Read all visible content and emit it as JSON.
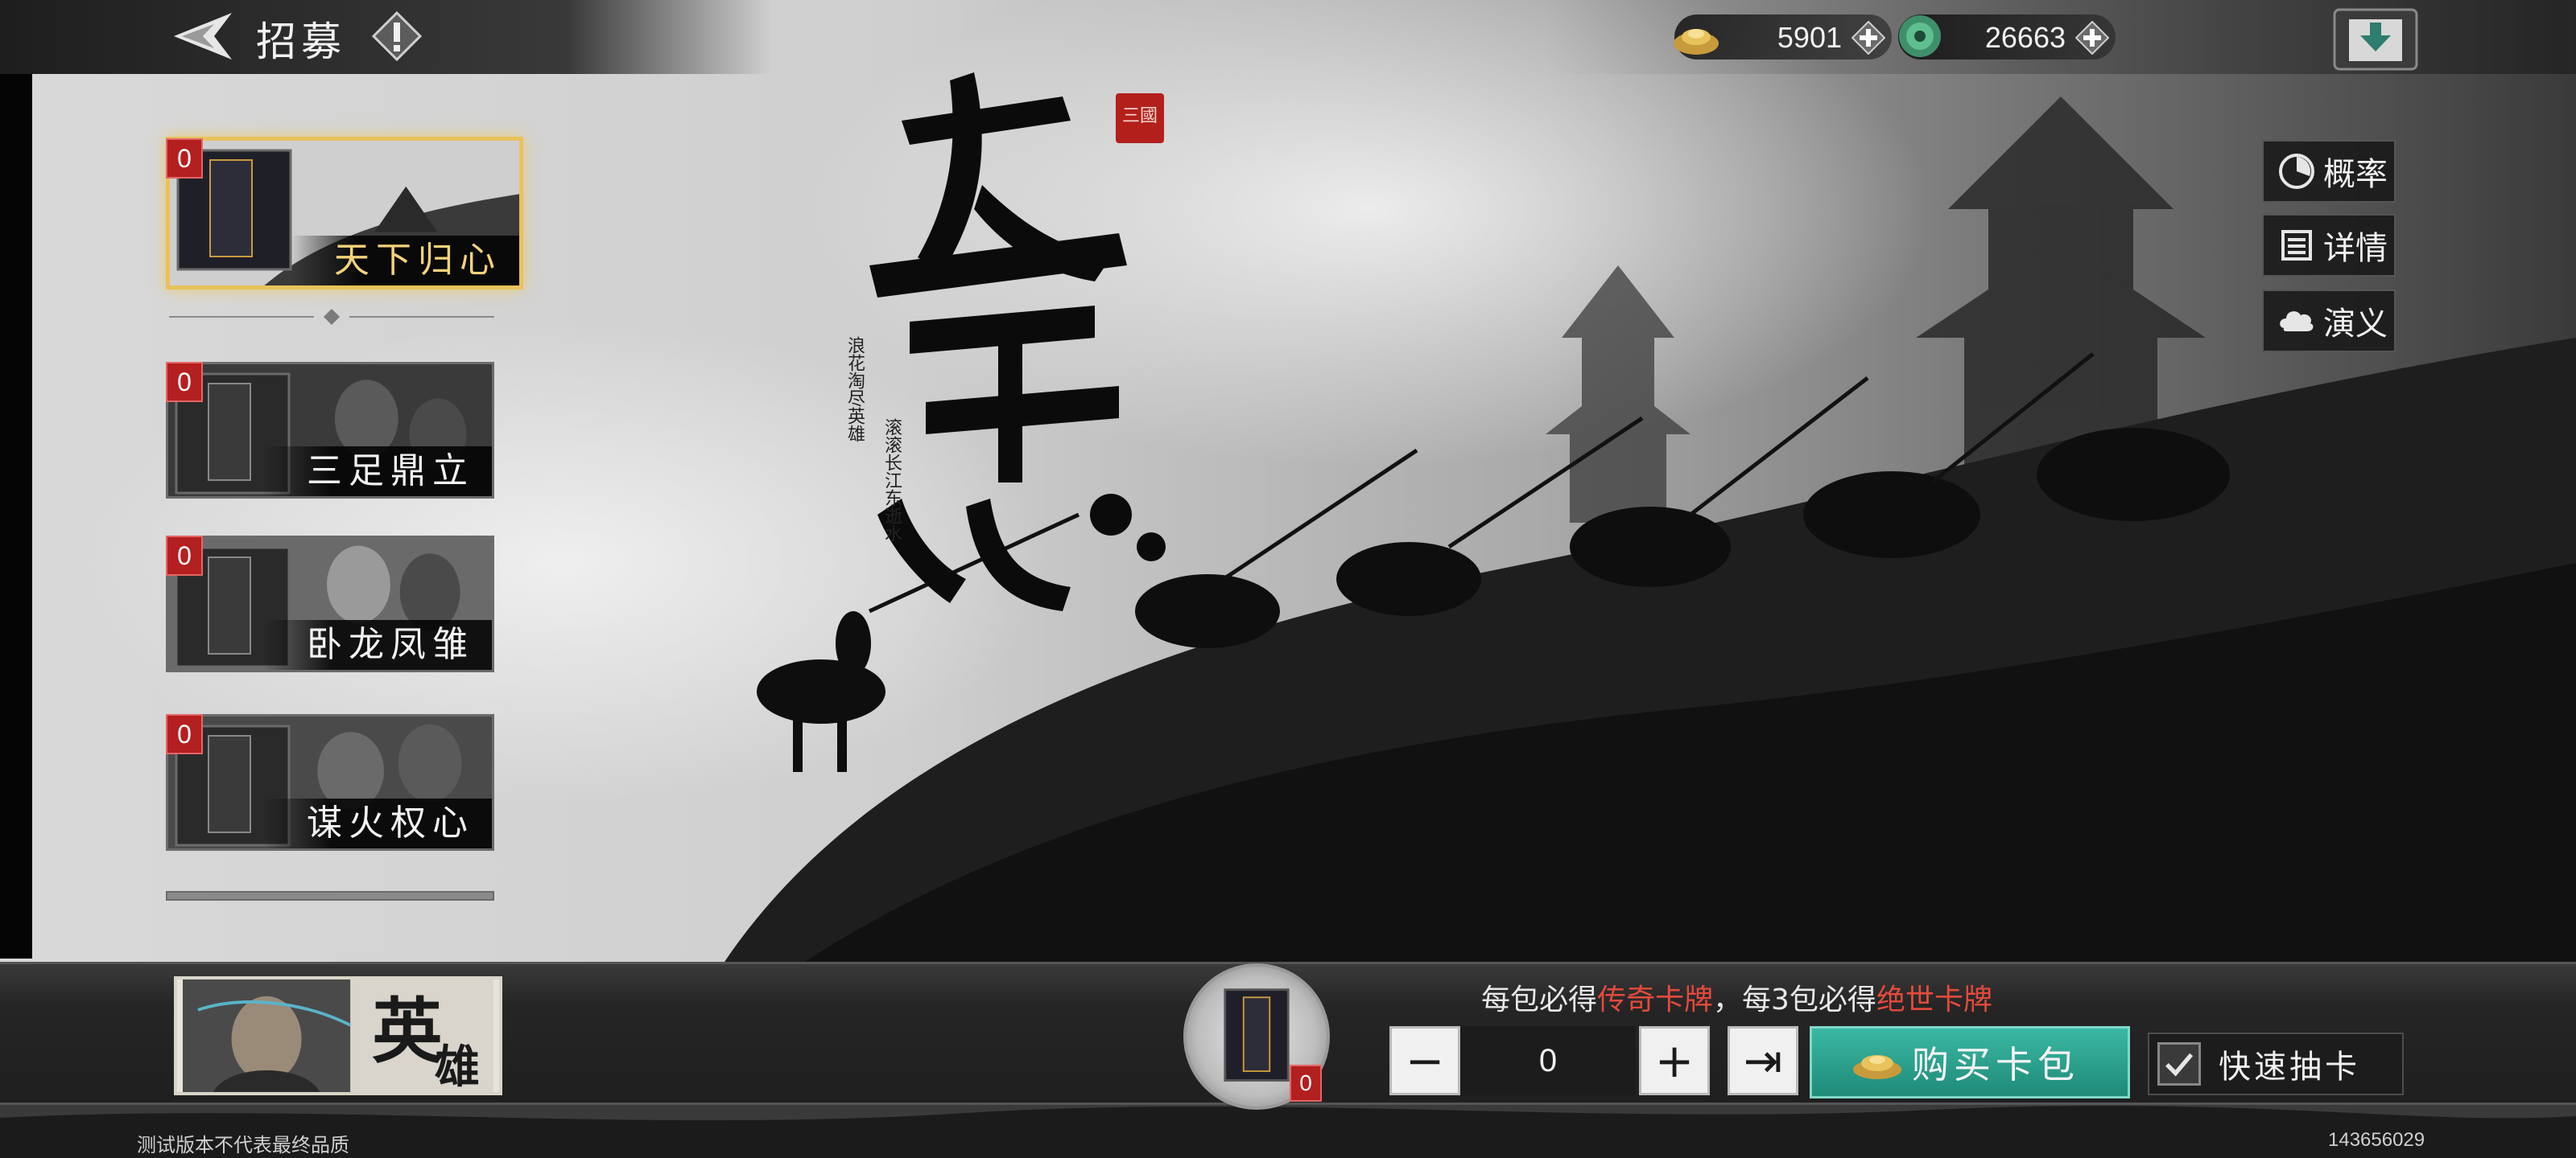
{
  "header": {
    "title": "招募",
    "back_icon": "back-arrow-icon",
    "info_icon": "info-icon"
  },
  "currencies": [
    {
      "name": "gold-ingot",
      "icon": "gold-ingot-icon",
      "value": "5901"
    },
    {
      "name": "jade",
      "icon": "jade-coin-icon",
      "value": "26663"
    }
  ],
  "packs": [
    {
      "label": "天下归心",
      "count": "0",
      "selected": true
    },
    {
      "label": "三足鼎立",
      "count": "0",
      "selected": false
    },
    {
      "label": "卧龙凤雏",
      "count": "0",
      "selected": false
    },
    {
      "label": "谋火权心",
      "count": "0",
      "selected": false
    }
  ],
  "side_buttons": [
    {
      "label": "概率",
      "icon": "probability-icon"
    },
    {
      "label": "详情",
      "icon": "details-icon"
    },
    {
      "label": "演义",
      "icon": "cloud-icon"
    }
  ],
  "banner": {
    "seal_text": "三國",
    "poem_left": "浪花淘尽英雄",
    "poem_right": "滚滚长江东逝水"
  },
  "bottom": {
    "hero_label_1": "英",
    "hero_label_2": "雄",
    "preview_count": "0",
    "promo_prefix": "每包必得",
    "promo_hl1": "传奇卡牌",
    "promo_mid": "，每3包必得",
    "promo_hl2": "绝世卡牌",
    "quantity": "0",
    "minus": "−",
    "plus": "+",
    "max": "⇥",
    "buy_label": "购买卡包",
    "quick_label": "快速抽卡",
    "quick_checked": true
  },
  "footer": {
    "note": "测试版本不代表最终品质",
    "id": "143656029"
  },
  "colors": {
    "gold_border": "#e8c25a",
    "badge_red": "#b41f1f",
    "buy_teal": "#2aa08c",
    "promo_red": "#e44a3c"
  }
}
